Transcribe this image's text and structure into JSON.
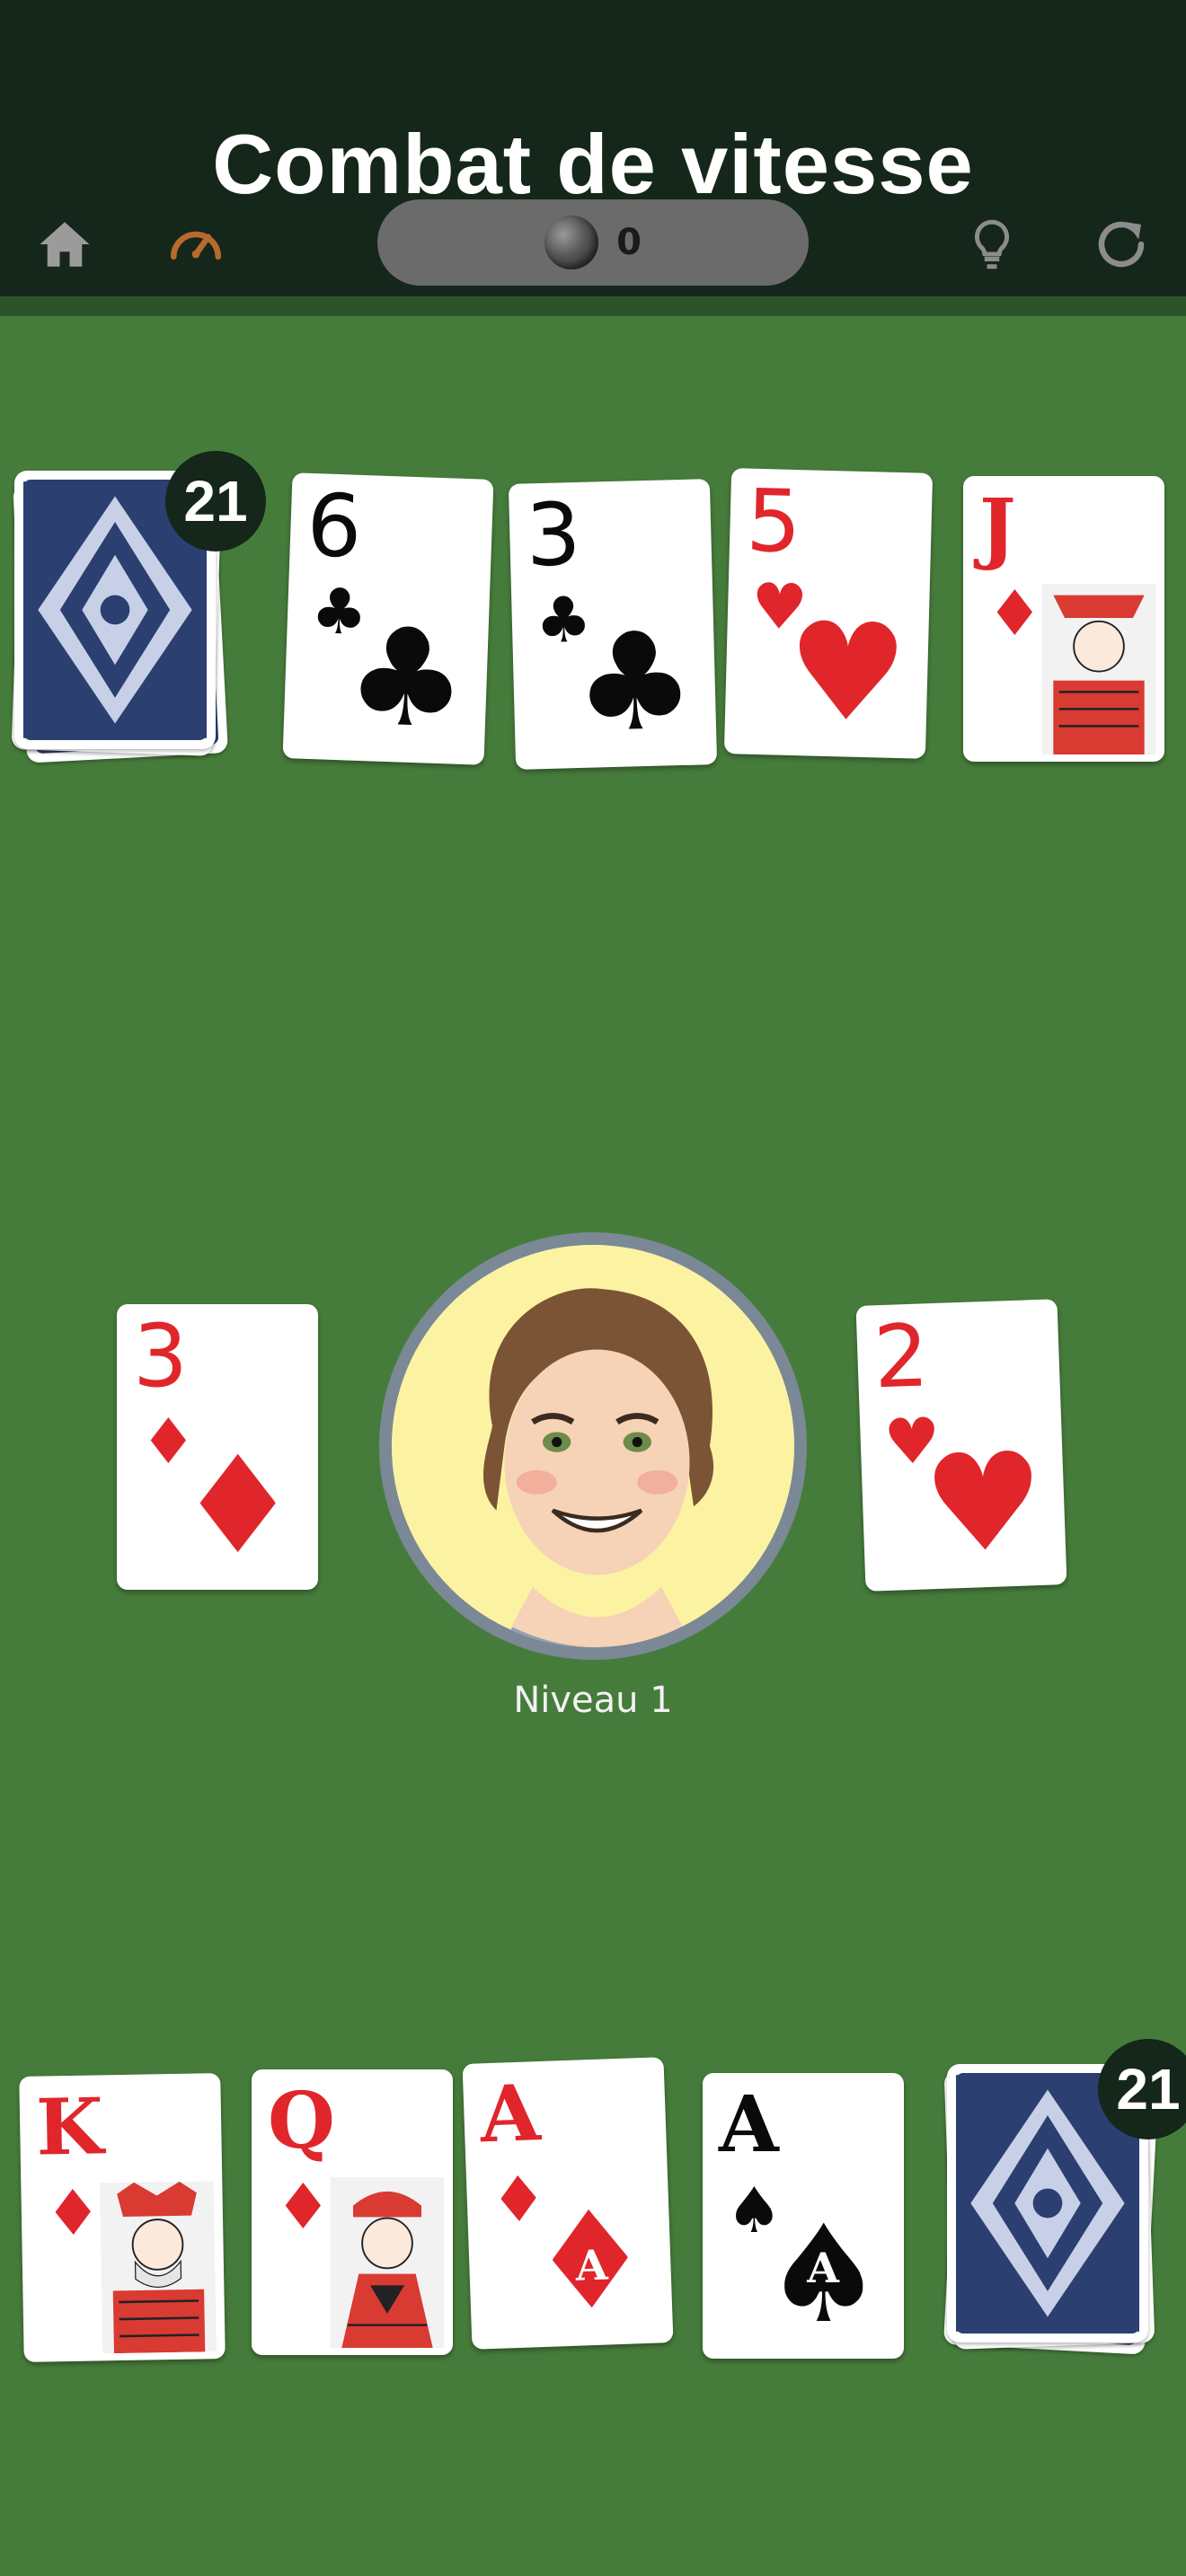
{
  "header": {
    "title": "Combat de vitesse",
    "home_icon": "home-icon",
    "speed_icon": "speedometer-icon",
    "hint_icon": "lightbulb-icon",
    "restart_icon": "restart-icon",
    "score": "0",
    "coin_icon": "coin-icon"
  },
  "colors": {
    "table": "#467c3b",
    "header": "#15261a",
    "red_suit": "#e0262b",
    "speed_icon": "#b86a2c",
    "icon_gray": "#8c8c8c"
  },
  "opponent": {
    "deck_count": "21",
    "cards": [
      {
        "rank": "6",
        "suit": "♣",
        "color": "black"
      },
      {
        "rank": "3",
        "suit": "♣",
        "color": "black"
      },
      {
        "rank": "5",
        "suit": "♥",
        "color": "red"
      },
      {
        "rank": "J",
        "suit": "♦",
        "color": "red"
      }
    ]
  },
  "center": {
    "left_pile": {
      "rank": "3",
      "suit": "♦",
      "color": "red"
    },
    "right_pile": {
      "rank": "2",
      "suit": "♥",
      "color": "red"
    },
    "level": "Niveau 1"
  },
  "player": {
    "deck_count": "21",
    "cards": [
      {
        "rank": "K",
        "suit": "♦",
        "color": "red"
      },
      {
        "rank": "Q",
        "suit": "♦",
        "color": "red"
      },
      {
        "rank": "A",
        "suit": "♦",
        "color": "red"
      },
      {
        "rank": "A",
        "suit": "♠",
        "color": "black"
      }
    ]
  }
}
